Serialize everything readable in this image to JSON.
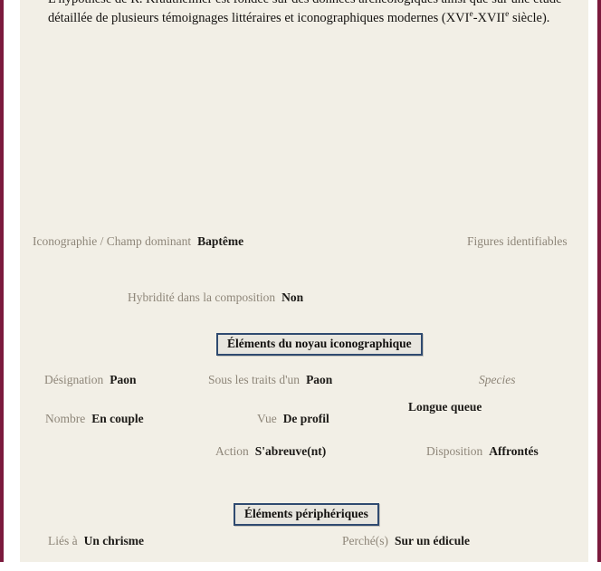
{
  "document": {
    "intro_paragraph": "L'hypothèse de R. Krautheimer est fondée sur des données archéologiques ainsi que sur une étude détaillée de plusieurs témoignages littéraires et iconographiques modernes (XVIe-XVIIe siècle).",
    "intro_line1": "L'hypothèse de R. Krautheimer est fondée sur des données archéologiques ainsi que sur une étude détaillée de",
    "intro_line2_a": "plusieurs témoignages littéraires et iconographiques modernes (XVI",
    "intro_line2_sup1": "e",
    "intro_line2_b": "-XVII",
    "intro_line2_sup2": "e",
    "intro_line2_c": " siècle)."
  },
  "overview": {
    "iconographie_label": "Iconographie / Champ dominant",
    "iconographie_value": "Baptême",
    "figures_label": "Figures identifiables",
    "hybridite_label": "Hybridité dans la composition",
    "hybridite_value": "Non"
  },
  "sections": {
    "noyau_title": "Éléments du noyau iconographique",
    "peripheriques_title": "Éléments périphériques"
  },
  "noyau": {
    "designation_label": "Désignation",
    "designation_value": "Paon",
    "sous_les_traits_label": "Sous les traits d'un",
    "sous_les_traits_value": "Paon",
    "species_label": "Species",
    "species_value": "Longue queue",
    "nombre_label": "Nombre",
    "nombre_value": "En couple",
    "vue_label": "Vue",
    "vue_value": "De profil",
    "action_label": "Action",
    "action_value": "S'abreuve(nt)",
    "disposition_label": "Disposition",
    "disposition_value": "Affrontés"
  },
  "peripheriques": {
    "lies_a_label": "Liés à",
    "lies_a_value": "Un chrisme",
    "perche_label": "Perché(s)",
    "perche_value": "Sur un édicule"
  },
  "colors": {
    "page_border": "#7b1a3d",
    "sheet_background": "#f2efe6",
    "label_text": "#8e8679",
    "value_text": "#1c1a17",
    "section_box_border": "#2f4a70",
    "section_box_fill": "#e8e6df"
  }
}
